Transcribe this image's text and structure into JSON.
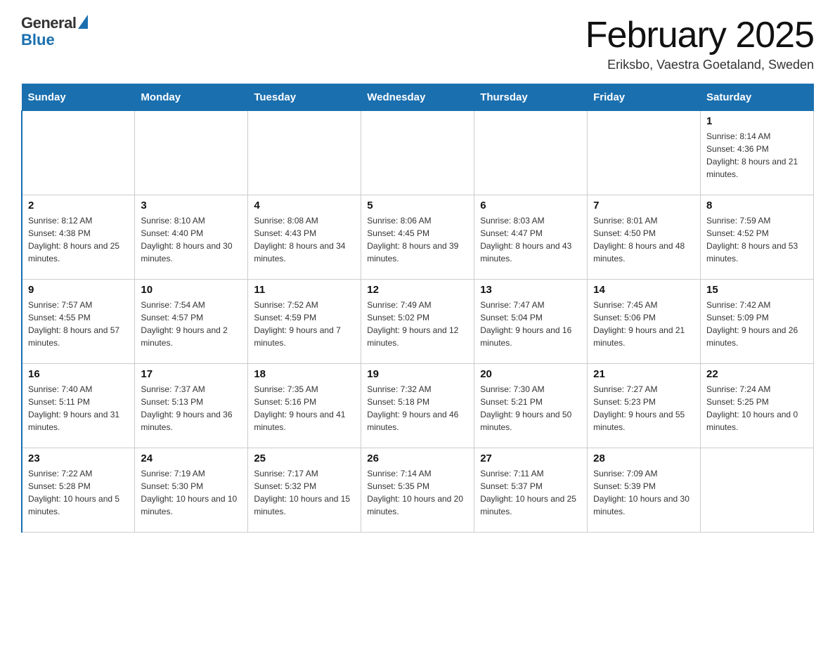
{
  "logo": {
    "general": "General",
    "blue": "Blue"
  },
  "title": "February 2025",
  "subtitle": "Eriksbo, Vaestra Goetaland, Sweden",
  "header_days": [
    "Sunday",
    "Monday",
    "Tuesday",
    "Wednesday",
    "Thursday",
    "Friday",
    "Saturday"
  ],
  "weeks": [
    [
      {
        "day": "",
        "info": ""
      },
      {
        "day": "",
        "info": ""
      },
      {
        "day": "",
        "info": ""
      },
      {
        "day": "",
        "info": ""
      },
      {
        "day": "",
        "info": ""
      },
      {
        "day": "",
        "info": ""
      },
      {
        "day": "1",
        "info": "Sunrise: 8:14 AM\nSunset: 4:36 PM\nDaylight: 8 hours and 21 minutes."
      }
    ],
    [
      {
        "day": "2",
        "info": "Sunrise: 8:12 AM\nSunset: 4:38 PM\nDaylight: 8 hours and 25 minutes."
      },
      {
        "day": "3",
        "info": "Sunrise: 8:10 AM\nSunset: 4:40 PM\nDaylight: 8 hours and 30 minutes."
      },
      {
        "day": "4",
        "info": "Sunrise: 8:08 AM\nSunset: 4:43 PM\nDaylight: 8 hours and 34 minutes."
      },
      {
        "day": "5",
        "info": "Sunrise: 8:06 AM\nSunset: 4:45 PM\nDaylight: 8 hours and 39 minutes."
      },
      {
        "day": "6",
        "info": "Sunrise: 8:03 AM\nSunset: 4:47 PM\nDaylight: 8 hours and 43 minutes."
      },
      {
        "day": "7",
        "info": "Sunrise: 8:01 AM\nSunset: 4:50 PM\nDaylight: 8 hours and 48 minutes."
      },
      {
        "day": "8",
        "info": "Sunrise: 7:59 AM\nSunset: 4:52 PM\nDaylight: 8 hours and 53 minutes."
      }
    ],
    [
      {
        "day": "9",
        "info": "Sunrise: 7:57 AM\nSunset: 4:55 PM\nDaylight: 8 hours and 57 minutes."
      },
      {
        "day": "10",
        "info": "Sunrise: 7:54 AM\nSunset: 4:57 PM\nDaylight: 9 hours and 2 minutes."
      },
      {
        "day": "11",
        "info": "Sunrise: 7:52 AM\nSunset: 4:59 PM\nDaylight: 9 hours and 7 minutes."
      },
      {
        "day": "12",
        "info": "Sunrise: 7:49 AM\nSunset: 5:02 PM\nDaylight: 9 hours and 12 minutes."
      },
      {
        "day": "13",
        "info": "Sunrise: 7:47 AM\nSunset: 5:04 PM\nDaylight: 9 hours and 16 minutes."
      },
      {
        "day": "14",
        "info": "Sunrise: 7:45 AM\nSunset: 5:06 PM\nDaylight: 9 hours and 21 minutes."
      },
      {
        "day": "15",
        "info": "Sunrise: 7:42 AM\nSunset: 5:09 PM\nDaylight: 9 hours and 26 minutes."
      }
    ],
    [
      {
        "day": "16",
        "info": "Sunrise: 7:40 AM\nSunset: 5:11 PM\nDaylight: 9 hours and 31 minutes."
      },
      {
        "day": "17",
        "info": "Sunrise: 7:37 AM\nSunset: 5:13 PM\nDaylight: 9 hours and 36 minutes."
      },
      {
        "day": "18",
        "info": "Sunrise: 7:35 AM\nSunset: 5:16 PM\nDaylight: 9 hours and 41 minutes."
      },
      {
        "day": "19",
        "info": "Sunrise: 7:32 AM\nSunset: 5:18 PM\nDaylight: 9 hours and 46 minutes."
      },
      {
        "day": "20",
        "info": "Sunrise: 7:30 AM\nSunset: 5:21 PM\nDaylight: 9 hours and 50 minutes."
      },
      {
        "day": "21",
        "info": "Sunrise: 7:27 AM\nSunset: 5:23 PM\nDaylight: 9 hours and 55 minutes."
      },
      {
        "day": "22",
        "info": "Sunrise: 7:24 AM\nSunset: 5:25 PM\nDaylight: 10 hours and 0 minutes."
      }
    ],
    [
      {
        "day": "23",
        "info": "Sunrise: 7:22 AM\nSunset: 5:28 PM\nDaylight: 10 hours and 5 minutes."
      },
      {
        "day": "24",
        "info": "Sunrise: 7:19 AM\nSunset: 5:30 PM\nDaylight: 10 hours and 10 minutes."
      },
      {
        "day": "25",
        "info": "Sunrise: 7:17 AM\nSunset: 5:32 PM\nDaylight: 10 hours and 15 minutes."
      },
      {
        "day": "26",
        "info": "Sunrise: 7:14 AM\nSunset: 5:35 PM\nDaylight: 10 hours and 20 minutes."
      },
      {
        "day": "27",
        "info": "Sunrise: 7:11 AM\nSunset: 5:37 PM\nDaylight: 10 hours and 25 minutes."
      },
      {
        "day": "28",
        "info": "Sunrise: 7:09 AM\nSunset: 5:39 PM\nDaylight: 10 hours and 30 minutes."
      },
      {
        "day": "",
        "info": ""
      }
    ]
  ]
}
